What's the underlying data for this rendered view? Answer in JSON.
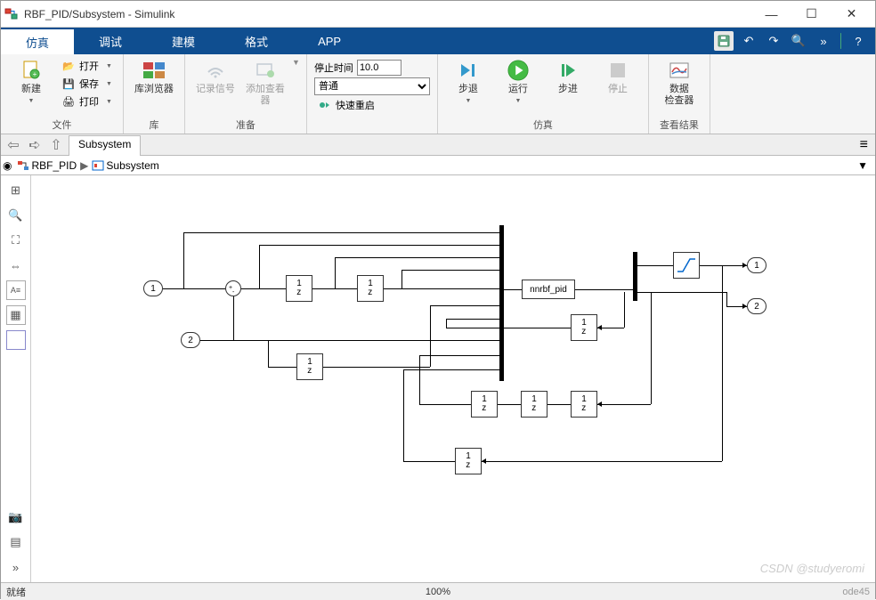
{
  "window": {
    "title": "RBF_PID/Subsystem - Simulink"
  },
  "tabs": {
    "sim": "仿真",
    "debug": "调试",
    "model": "建模",
    "format": "格式",
    "app": "APP"
  },
  "toolstrip": {
    "file": {
      "new": "新建",
      "open": "打开",
      "save": "保存",
      "print": "打印",
      "group": "文件"
    },
    "lib": {
      "browser": "库浏览器",
      "group": "库"
    },
    "prep": {
      "logsig": "记录信号",
      "addview": "添加查看器",
      "group": "准备"
    },
    "simprep": {
      "stoplabel": "停止时间",
      "stoptime": "10.0",
      "mode": "普通",
      "restart": "快速重启"
    },
    "sim": {
      "stepback": "步退",
      "run": "运行",
      "stepfwd": "步进",
      "stop": "停止",
      "group": "仿真"
    },
    "results": {
      "insp": "数据\n检查器",
      "group": "查看结果"
    }
  },
  "nav": {
    "subsystem": "Subsystem"
  },
  "breadcrumb": {
    "root": "RBF_PID",
    "sub": "Subsystem"
  },
  "status": {
    "ready": "就绪",
    "zoom": "100%",
    "solver": "ode45"
  },
  "diagram": {
    "in1": "1",
    "in2": "2",
    "out1": "1",
    "out2": "2",
    "delay": "1\nz",
    "fn": "nnrbf_pid"
  },
  "watermark": "CSDN @studyeromi"
}
